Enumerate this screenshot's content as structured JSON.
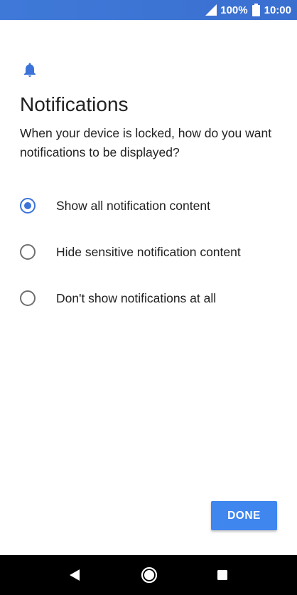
{
  "status_bar": {
    "battery_percent": "100%",
    "time": "10:00",
    "icons": [
      "signal-icon",
      "battery-icon"
    ]
  },
  "header": {
    "icon": "bell-icon",
    "title": "Notifications",
    "description": "When your device is locked, how do you want notifications to be displayed?"
  },
  "options": [
    {
      "label": "Show all notification content",
      "selected": true
    },
    {
      "label": "Hide sensitive notification content",
      "selected": false
    },
    {
      "label": "Don't show notifications at all",
      "selected": false
    }
  ],
  "actions": {
    "done_label": "DONE"
  },
  "nav_bar": {
    "icons": [
      "back-icon",
      "home-icon",
      "recents-icon"
    ]
  },
  "colors": {
    "accent": "#3c73d9",
    "button": "#3f86ee",
    "status_bar": "#3c74d4"
  }
}
